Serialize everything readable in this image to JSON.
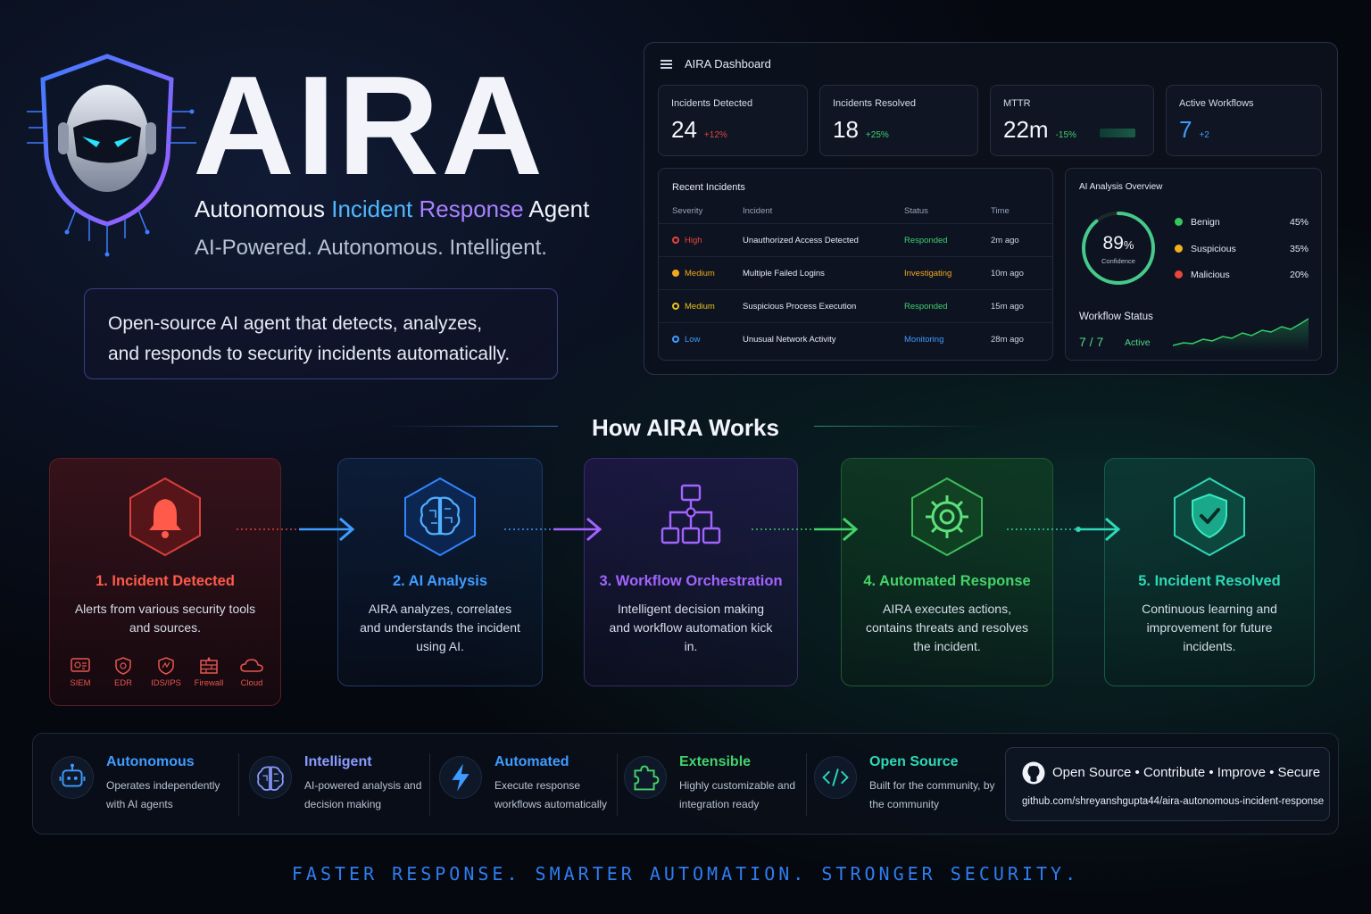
{
  "hero": {
    "title": "AIRA",
    "subtitle_part1": "Autonomous ",
    "subtitle_part2": "Incident",
    "subtitle_part3": " Response",
    "subtitle_part4": " Agent",
    "tagline": "AI-Powered. Autonomous. Intelligent.",
    "description_line1": "Open-source AI agent that detects, analyzes,",
    "description_line2": "and responds to security incidents automatically."
  },
  "dashboard": {
    "title": "AIRA Dashboard",
    "stats": [
      {
        "label": "Incidents Detected",
        "value": "24",
        "delta": "+12%",
        "delta_color": "#e0453f"
      },
      {
        "label": "Incidents Resolved",
        "value": "18",
        "delta": "+25%",
        "delta_color": "#3fcf72"
      },
      {
        "label": "MTTR",
        "value": "22m",
        "delta": "-15%",
        "delta_color": "#3fcf72"
      },
      {
        "label": "Active Workflows",
        "value": "7",
        "delta": "+2",
        "delta_color": "#3f9cff"
      }
    ],
    "recent": {
      "title": "Recent Incidents",
      "headers": [
        "Severity",
        "Incident",
        "Status",
        "Time"
      ],
      "rows": [
        {
          "severity": "High",
          "sev_color": "#e8453c",
          "incident": "Unauthorized Access Detected",
          "status": "Responded",
          "status_color": "#3fcf72",
          "time": "2m ago"
        },
        {
          "severity": "Medium",
          "sev_color": "#f2a91e",
          "incident": "Multiple Failed Logins",
          "status": "Investigating",
          "status_color": "#f2a91e",
          "time": "10m ago"
        },
        {
          "severity": "Medium",
          "sev_color": "#e8c21e",
          "incident": "Suspicious Process Execution",
          "status": "Responded",
          "status_color": "#3fcf72",
          "time": "15m ago"
        },
        {
          "severity": "Low",
          "sev_color": "#3f9cff",
          "incident": "Unusual Network Activity",
          "status": "Monitoring",
          "status_color": "#3f9cff",
          "time": "28m ago"
        }
      ]
    },
    "ai_overview": {
      "title": "AI Analysis Overview",
      "confidence_value": "89",
      "confidence_unit": "%",
      "confidence_label": "Confidence",
      "confidence_fraction": 0.89,
      "legend": [
        {
          "label": "Benign",
          "pct": "45%",
          "color": "#34c759"
        },
        {
          "label": "Suspicious",
          "pct": "35%",
          "color": "#f2b01e"
        },
        {
          "label": "Malicious",
          "pct": "20%",
          "color": "#e8453c"
        }
      ],
      "workflow_title": "Workflow Status",
      "workflow_value": "7 / 7",
      "workflow_state": "Active"
    }
  },
  "how": {
    "title": "How AIRA Works",
    "steps": [
      {
        "title": "1. Incident Detected",
        "desc": "Alerts from various security tools and sources.",
        "color": "#ff4d42",
        "icon": "bell-icon"
      },
      {
        "title": "2. AI Analysis",
        "desc": "AIRA analyzes, correlates and understands the incident using AI.",
        "color": "#3f9cff",
        "icon": "brain-icon"
      },
      {
        "title": "3. Workflow Orchestration",
        "desc": "Intelligent decision making and workflow automation kick in.",
        "color": "#a264ff",
        "icon": "workflow-icon"
      },
      {
        "title": "4. Automated Response",
        "desc": "AIRA executes actions, contains threats and resolves the incident.",
        "color": "#43d36a",
        "icon": "gear-icon"
      },
      {
        "title": "5. Incident Resolved",
        "desc": "Continuous learning and improvement for future incidents.",
        "color": "#2fd8b6",
        "icon": "shield-check-icon"
      }
    ],
    "sources": [
      "SIEM",
      "EDR",
      "IDS/IPS",
      "Firewall",
      "Cloud"
    ]
  },
  "features": [
    {
      "title": "Autonomous",
      "desc": "Operates independently with AI agents",
      "color": "#3f9cff",
      "icon": "robot-icon"
    },
    {
      "title": "Intelligent",
      "desc": "AI-powered analysis and decision making",
      "color": "#8a9cff",
      "icon": "brain-icon"
    },
    {
      "title": "Automated",
      "desc": "Execute response workflows automatically",
      "color": "#3f9cff",
      "icon": "lightning-icon"
    },
    {
      "title": "Extensible",
      "desc": "Highly customizable and integration ready",
      "color": "#43d36a",
      "icon": "puzzle-icon"
    },
    {
      "title": "Open Source",
      "desc": "Built for the community, by the community",
      "color": "#2fd8b6",
      "icon": "code-icon"
    }
  ],
  "github": {
    "line": "Open Source • Contribute • Improve • Secure",
    "url": "github.com/shreyanshgupta44/aira-autonomous-incident-response"
  },
  "footer": "FASTER RESPONSE. SMARTER AUTOMATION. STRONGER SECURITY."
}
